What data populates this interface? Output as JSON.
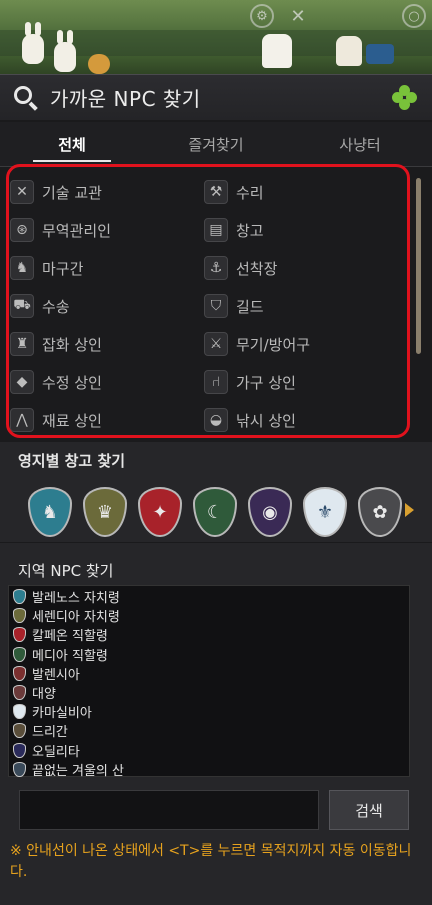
{
  "header": {
    "title": "가까운 NPC 찾기"
  },
  "tabs": [
    {
      "label": "전체",
      "active": true
    },
    {
      "label": "즐겨찾기",
      "active": false
    },
    {
      "label": "사냥터",
      "active": false
    }
  ],
  "categories": [
    {
      "label": "기술 교관",
      "icon": "crossed-tools-icon",
      "glyph": "✕"
    },
    {
      "label": "수리",
      "icon": "anvil-icon",
      "glyph": "⚒"
    },
    {
      "label": "무역관리인",
      "icon": "wheel-icon",
      "glyph": "⊛"
    },
    {
      "label": "창고",
      "icon": "chest-icon",
      "glyph": "▤"
    },
    {
      "label": "마구간",
      "icon": "horse-icon",
      "glyph": "♞"
    },
    {
      "label": "선착장",
      "icon": "anchor-icon",
      "glyph": "⚓"
    },
    {
      "label": "수송",
      "icon": "wagon-icon",
      "glyph": "⛟"
    },
    {
      "label": "길드",
      "icon": "guild-crest-icon",
      "glyph": "⛉"
    },
    {
      "label": "잡화 상인",
      "icon": "sack-icon",
      "glyph": "♜"
    },
    {
      "label": "무기/방어구",
      "icon": "sword-icon",
      "glyph": "⚔"
    },
    {
      "label": "수정 상인",
      "icon": "crystal-icon",
      "glyph": "◆"
    },
    {
      "label": "가구 상인",
      "icon": "chair-icon",
      "glyph": "⑁"
    },
    {
      "label": "재료 상인",
      "icon": "pickaxe-icon",
      "glyph": "⋀"
    },
    {
      "label": "낚시 상인",
      "icon": "fish-icon",
      "glyph": "◒"
    }
  ],
  "storage_section": {
    "title": "영지별 창고 찾기"
  },
  "storage_crests": [
    {
      "name": "balenos-crest-icon",
      "bg": "#2d7d8f",
      "glyph": "♞"
    },
    {
      "name": "serendia-crest-icon",
      "bg": "#6b6a3a",
      "glyph": "♛"
    },
    {
      "name": "calpheon-crest-icon",
      "bg": "#a8222a",
      "glyph": "✦"
    },
    {
      "name": "mediah-crest-icon",
      "bg": "#2f5a3a",
      "glyph": "☾"
    },
    {
      "name": "valencia-crest-icon",
      "bg": "#3a2a55",
      "glyph": "◉"
    },
    {
      "name": "kamasylvia-crest-icon",
      "bg": "#dfe8ef",
      "glyph": "⚜"
    },
    {
      "name": "drieghan-crest-icon",
      "bg": "#4a4a4d",
      "glyph": "✿"
    }
  ],
  "region_section": {
    "title": "지역 NPC 찾기"
  },
  "regions": [
    {
      "label": "발레노스 자치령",
      "color": "#2d7d8f"
    },
    {
      "label": "세렌디아 자치령",
      "color": "#6b6a3a"
    },
    {
      "label": "칼페온 직할령",
      "color": "#a8222a"
    },
    {
      "label": "메디아 직할령",
      "color": "#2f5a3a"
    },
    {
      "label": "발렌시아",
      "color": "#7a2f2f"
    },
    {
      "label": "대양",
      "color": "#6a3a3a"
    },
    {
      "label": "카마실비아",
      "color": "#dfe8ef"
    },
    {
      "label": "드리간",
      "color": "#5a4e3a"
    },
    {
      "label": "오딜리타",
      "color": "#2a2a5a"
    },
    {
      "label": "끝없는 겨울의 산",
      "color": "#3a4a5a"
    }
  ],
  "search": {
    "placeholder": "",
    "button_label": "검색"
  },
  "notice": "※ 안내선이 나온 상태에서 <T>를 누르면 목적지까지 자동 이동합니다.",
  "colors": {
    "accent": "#e1121d",
    "notice": "#e6a21e",
    "arrow": "#d9a030"
  }
}
